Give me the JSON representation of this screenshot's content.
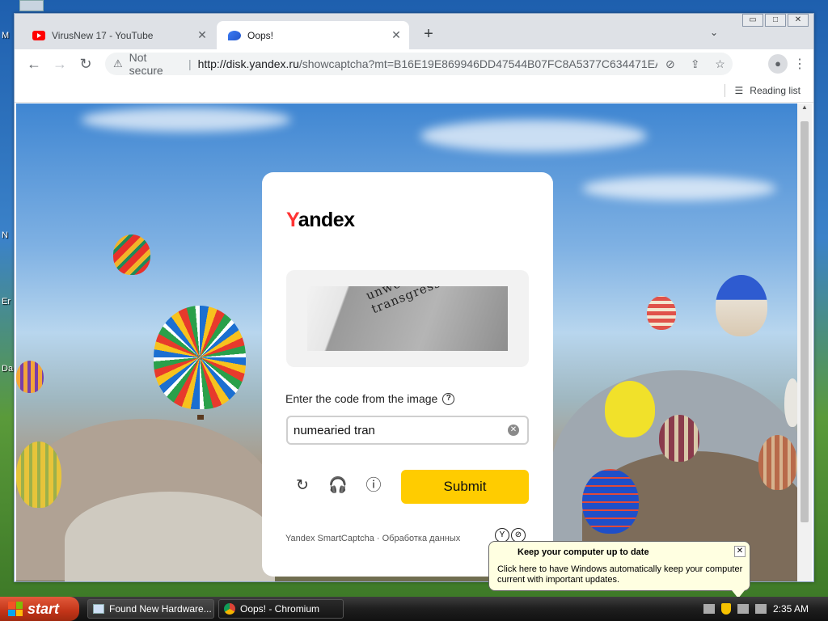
{
  "desktop": {
    "labels": [
      "M",
      "N",
      "Er",
      "Da"
    ]
  },
  "window": {
    "controls": [
      "▭",
      "□",
      "✕"
    ]
  },
  "tabs": [
    {
      "title": "VirusNew 17 - YouTube",
      "favicon": "youtube-icon"
    },
    {
      "title": "Oops!",
      "favicon": "yandex-disk-icon"
    }
  ],
  "toolbar": {
    "security_label": "Not secure",
    "url_host": "http://disk.yandex.ru",
    "url_path": "/showcaptcha?mt=B16E19E869946DD47544B07FC8A5377C634471EA...",
    "reading_list": "Reading list"
  },
  "card": {
    "logo_y": "Y",
    "logo_rest": "andex",
    "captcha_text": "unwearied transgress",
    "code_label": "Enter the code from the image",
    "input_value": "numearied tran",
    "submit_label": "Submit",
    "footer_text": "Yandex SmartCaptcha · Обработка данных"
  },
  "notification": {
    "title": "Keep your computer up to date",
    "body": "Click here to have Windows automatically keep your computer current with important updates."
  },
  "taskbar": {
    "start_label": "start",
    "tasks": [
      "Found New Hardware...",
      "Oops! - Chromium"
    ],
    "clock": "2:35 AM"
  },
  "colors": {
    "yandex_red": "#ff3333",
    "submit_yellow": "#ffcc00",
    "xp_start": "#c23418"
  }
}
